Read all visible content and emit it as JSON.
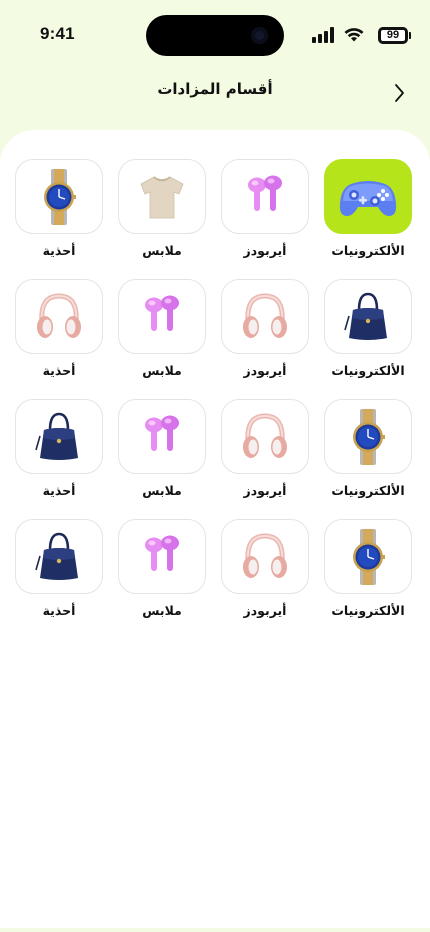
{
  "status_bar": {
    "time": "9:41",
    "battery": "99"
  },
  "header": {
    "title": "أقسام المزادات",
    "back_icon": "chevron-right-icon"
  },
  "colors": {
    "accent": "#b5e41a",
    "page_bg": "#f3fbe3",
    "tile_border": "#e4e4e4"
  },
  "categories": [
    [
      {
        "label": "الألكترونيات",
        "icon": "game-controller-icon",
        "selected": true
      },
      {
        "label": "أيربودز",
        "icon": "earbuds-icon",
        "selected": false
      },
      {
        "label": "ملابس",
        "icon": "tshirt-icon",
        "selected": false
      },
      {
        "label": "أحذية",
        "icon": "wristwatch-icon",
        "selected": false
      }
    ],
    [
      {
        "label": "الألكترونيات",
        "icon": "handbag-icon",
        "selected": false
      },
      {
        "label": "أيربودز",
        "icon": "headphones-icon",
        "selected": false
      },
      {
        "label": "ملابس",
        "icon": "earbuds-icon",
        "selected": false
      },
      {
        "label": "أحذية",
        "icon": "headphones-icon",
        "selected": false
      }
    ],
    [
      {
        "label": "الألكترونيات",
        "icon": "wristwatch-icon",
        "selected": false
      },
      {
        "label": "أيربودز",
        "icon": "headphones-icon",
        "selected": false
      },
      {
        "label": "ملابس",
        "icon": "earbuds-icon",
        "selected": false
      },
      {
        "label": "أحذية",
        "icon": "handbag-icon",
        "selected": false
      }
    ],
    [
      {
        "label": "الألكترونيات",
        "icon": "wristwatch-icon",
        "selected": false
      },
      {
        "label": "أيربودز",
        "icon": "headphones-icon",
        "selected": false
      },
      {
        "label": "ملابس",
        "icon": "earbuds-icon",
        "selected": false
      },
      {
        "label": "أحذية",
        "icon": "handbag-icon",
        "selected": false
      }
    ]
  ]
}
